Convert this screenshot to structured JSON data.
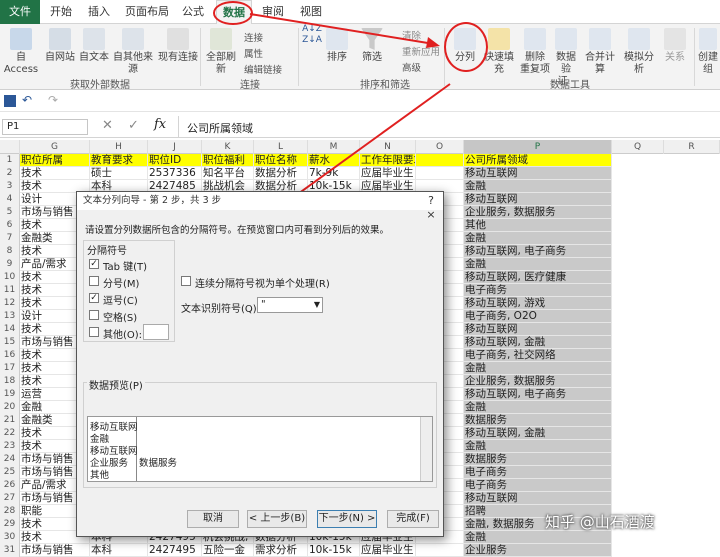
{
  "menu": {
    "tabs": [
      "文件",
      "开始",
      "插入",
      "页面布局",
      "公式",
      "数据",
      "审阅",
      "视图"
    ]
  },
  "ribbon": {
    "ext_from_access": "自 Access",
    "ext_from_web": "自网站",
    "ext_from_text": "自文本",
    "ext_from_other": "自其他来源",
    "existing": "现有连接",
    "group_external": "获取外部数据",
    "refresh_all": "全部刷新",
    "connections": "连接",
    "properties": "属性",
    "edit_links": "编辑链接",
    "group_connections": "连接",
    "sort": "排序",
    "filter": "筛选",
    "clear": "清除",
    "reapply": "重新应用",
    "advanced": "高级",
    "group_sort": "排序和筛选",
    "text_to_columns": "分列",
    "flash_fill": "快速填充",
    "remove_dup": "删除\n重复项",
    "validation": "数据验\n证 -",
    "consolidate": "合并计算",
    "what_if": "模拟分析",
    "relations": "关系",
    "group_tools": "数据工具",
    "create_group": "创建组"
  },
  "formula_bar": {
    "name_box": "P1",
    "content": "公司所属领域",
    "fx": "fx"
  },
  "columns": [
    "G",
    "H",
    "J",
    "K",
    "L",
    "M",
    "N",
    "O",
    "P",
    "Q",
    "R"
  ],
  "header_row": [
    "职位所属",
    "教育要求",
    "职位ID",
    "职位福利",
    "职位名称",
    "薪水",
    "工作年限要求",
    "",
    "公司所属领域"
  ],
  "rows": [
    {
      "n": "2",
      "g": "技术",
      "h": "硕士",
      "j": "2537336",
      "k": "知名平台",
      "l": "数据分析",
      "m": "7k-9k",
      "n2": "应届毕业生",
      "p": "移动互联网"
    },
    {
      "n": "3",
      "g": "技术",
      "h": "本科",
      "j": "2427485",
      "k": "挑战机会",
      "l": "数据分析",
      "m": "10k-15k",
      "n2": "应届毕业生",
      "p": "金融"
    },
    {
      "n": "4",
      "g": "设计",
      "h": "",
      "j": "",
      "k": "",
      "l": "",
      "m": "",
      "n2": "",
      "p": "移动互联网"
    },
    {
      "n": "5",
      "g": "市场与销售",
      "h": "",
      "j": "",
      "k": "",
      "l": "",
      "m": "",
      "n2": "",
      "p": "企业服务, 数据服务"
    },
    {
      "n": "6",
      "g": "技术",
      "h": "",
      "j": "",
      "k": "",
      "l": "",
      "m": "",
      "n2": "",
      "p": "其他"
    },
    {
      "n": "7",
      "g": "金融类",
      "h": "",
      "j": "",
      "k": "",
      "l": "",
      "m": "",
      "n2": "",
      "p": "金融"
    },
    {
      "n": "8",
      "g": "技术",
      "h": "",
      "j": "",
      "k": "",
      "l": "",
      "m": "",
      "n2": "",
      "p": "移动互联网, 电子商务"
    },
    {
      "n": "9",
      "g": "产品/需求",
      "h": "",
      "j": "",
      "k": "",
      "l": "",
      "m": "",
      "n2": "",
      "p": "金融"
    },
    {
      "n": "10",
      "g": "技术",
      "h": "",
      "j": "",
      "k": "",
      "l": "",
      "m": "",
      "n2": "",
      "p": "移动互联网, 医疗健康"
    },
    {
      "n": "11",
      "g": "技术",
      "h": "",
      "j": "",
      "k": "",
      "l": "",
      "m": "",
      "n2": "",
      "p": "电子商务"
    },
    {
      "n": "12",
      "g": "技术",
      "h": "",
      "j": "",
      "k": "",
      "l": "",
      "m": "",
      "n2": "",
      "p": "移动互联网, 游戏"
    },
    {
      "n": "13",
      "g": "设计",
      "h": "",
      "j": "",
      "k": "",
      "l": "",
      "m": "",
      "n2": "",
      "p": "电子商务, O2O"
    },
    {
      "n": "14",
      "g": "技术",
      "h": "",
      "j": "",
      "k": "",
      "l": "",
      "m": "",
      "n2": "",
      "p": "移动互联网"
    },
    {
      "n": "15",
      "g": "市场与销售",
      "h": "",
      "j": "",
      "k": "",
      "l": "",
      "m": "",
      "n2": "",
      "p": "移动互联网, 金融"
    },
    {
      "n": "16",
      "g": "技术",
      "h": "",
      "j": "",
      "k": "",
      "l": "",
      "m": "",
      "n2": "",
      "p": "电子商务, 社交网络"
    },
    {
      "n": "17",
      "g": "技术",
      "h": "",
      "j": "",
      "k": "",
      "l": "",
      "m": "",
      "n2": "",
      "p": "金融"
    },
    {
      "n": "18",
      "g": "技术",
      "h": "",
      "j": "",
      "k": "",
      "l": "",
      "m": "",
      "n2": "",
      "p": "企业服务, 数据服务"
    },
    {
      "n": "19",
      "g": "运营",
      "h": "",
      "j": "",
      "k": "",
      "l": "",
      "m": "",
      "n2": "",
      "p": "移动互联网, 电子商务"
    },
    {
      "n": "20",
      "g": "金融",
      "h": "",
      "j": "",
      "k": "",
      "l": "",
      "m": "",
      "n2": "",
      "p": "金融"
    },
    {
      "n": "21",
      "g": "金融类",
      "h": "",
      "j": "",
      "k": "",
      "l": "",
      "m": "",
      "n2": "",
      "p": "数据服务"
    },
    {
      "n": "22",
      "g": "技术",
      "h": "",
      "j": "",
      "k": "",
      "l": "",
      "m": "",
      "n2": "",
      "p": "移动互联网, 金融"
    },
    {
      "n": "23",
      "g": "技术",
      "h": "",
      "j": "",
      "k": "",
      "l": "",
      "m": "",
      "n2": "",
      "p": "金融"
    },
    {
      "n": "24",
      "g": "市场与销售",
      "h": "",
      "j": "",
      "k": "",
      "l": "",
      "m": "",
      "n2": "",
      "p": "数据服务"
    },
    {
      "n": "25",
      "g": "市场与销售",
      "h": "",
      "j": "",
      "k": "",
      "l": "",
      "m": "",
      "n2": "",
      "p": "电子商务"
    },
    {
      "n": "26",
      "g": "产品/需求",
      "h": "",
      "j": "",
      "k": "",
      "l": "",
      "m": "",
      "n2": "",
      "p": "电子商务"
    },
    {
      "n": "27",
      "g": "市场与销售",
      "h": "",
      "j": "",
      "k": "",
      "l": "",
      "m": "",
      "n2": "",
      "p": "移动互联网"
    },
    {
      "n": "28",
      "g": "职能",
      "h": "",
      "j": "",
      "k": "",
      "l": "",
      "m": "",
      "n2": "",
      "p": "招聘"
    },
    {
      "n": "29",
      "g": "技术",
      "h": "",
      "j": "",
      "k": "",
      "l": "",
      "m": "",
      "n2": "",
      "p": "金融, 数据服务"
    },
    {
      "n": "30",
      "g": "技术",
      "h": "本科",
      "j": "2427495",
      "k": "机会挑战,",
      "l": "数据分析",
      "m": "10k-15k",
      "n2": "应届毕业生",
      "p": "金融"
    },
    {
      "n": "31",
      "g": "市场与销售",
      "h": "本科",
      "j": "2427495",
      "k": "五险一金",
      "l": "需求分析",
      "m": "10k-15k",
      "n2": "应届毕业生",
      "p": "企业服务"
    }
  ],
  "dialog": {
    "title": "文本分列向导 - 第 2 步，共 3 步",
    "close": "?  ×",
    "instruction": "请设置分列数据所包含的分隔符号。在预览窗口内可看到分列后的效果。",
    "delimiters_label": "分隔符号",
    "tab": "Tab 键(T)",
    "semicolon": "分号(M)",
    "comma": "逗号(C)",
    "space": "空格(S)",
    "other": "其他(O):",
    "consecutive": "连续分隔符号视为单个处理(R)",
    "qualifier_label": "文本识别符号(Q):",
    "qualifier_value": "\"",
    "preview_label": "数据预览(P)",
    "preview": [
      [
        "移动互联网",
        ""
      ],
      [
        "金融",
        ""
      ],
      [
        "移动互联网",
        ""
      ],
      [
        "企业服务",
        "数据服务"
      ],
      [
        "其他",
        ""
      ]
    ],
    "cancel": "取消",
    "back": "< 上一步(B)",
    "next": "下一步(N) >",
    "finish": "完成(F)"
  },
  "watermark": "知乎 @山石酒渡"
}
